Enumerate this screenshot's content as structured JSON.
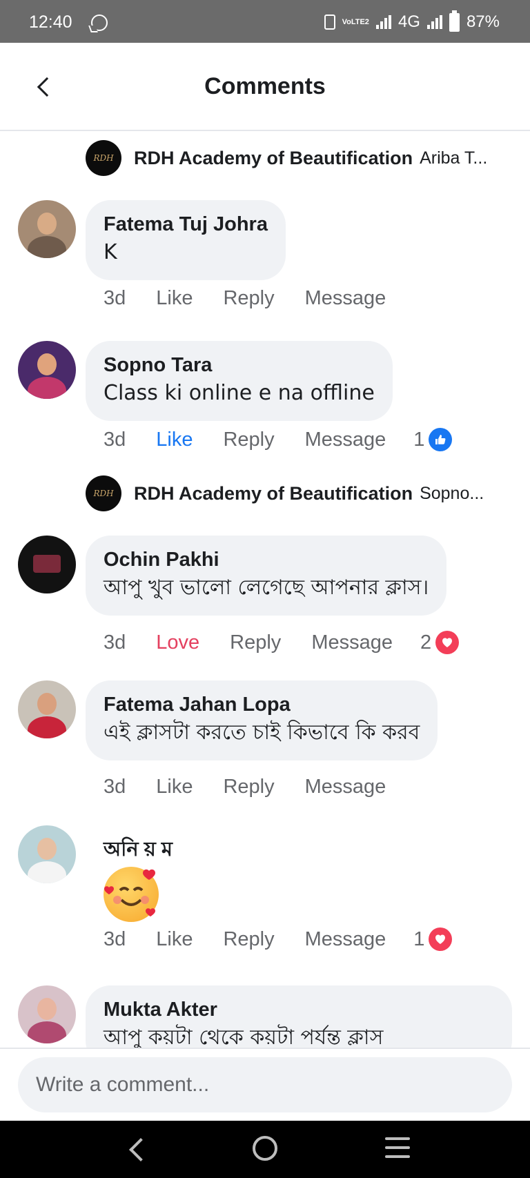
{
  "status_bar": {
    "time": "12:40",
    "network": "4G",
    "volte": "VoLTE2",
    "battery": "87%"
  },
  "header": {
    "title": "Comments"
  },
  "reply_previews": [
    {
      "author": "RDH Academy of Beautification",
      "snippet": "Ariba T..."
    },
    {
      "author": "RDH Academy of Beautification",
      "snippet": "Sopno..."
    }
  ],
  "comments": [
    {
      "name": "Fatema Tuj Johra",
      "text": "K",
      "time": "3d",
      "like": "Like",
      "reply": "Reply",
      "message": "Message"
    },
    {
      "name": "Sopno Tara",
      "text": "Class ki online e na offline",
      "time": "3d",
      "like": "Like",
      "reply": "Reply",
      "message": "Message",
      "reaction_count": "1",
      "reaction": "like"
    },
    {
      "name": "Ochin Pakhi",
      "text": "আপু খুব ভালো লেগেছে আপনার ক্লাস।",
      "time": "3d",
      "like": "Love",
      "reply": "Reply",
      "message": "Message",
      "reaction_count": "2",
      "reaction": "love"
    },
    {
      "name": "Fatema Jahan Lopa",
      "text": "এই ক্লাসটা করতে চাই কিভাবে কি করব",
      "time": "3d",
      "like": "Like",
      "reply": "Reply",
      "message": "Message"
    },
    {
      "name": "অনি য় ম",
      "text": "",
      "time": "3d",
      "like": "Like",
      "reply": "Reply",
      "message": "Message",
      "reaction_count": "1",
      "reaction": "love",
      "emoji": "smiling-face-with-hearts"
    },
    {
      "name": "Mukta Akter",
      "text": "আপু কয়টা থেকে কয়টা পর্যন্ত ক্লাস"
    }
  ],
  "composer": {
    "placeholder": "Write a comment..."
  },
  "colors": {
    "accent_blue": "#1877f2",
    "love_red": "#e4405f",
    "bubble_gray": "#f0f2f5",
    "meta_gray": "#65676b"
  }
}
